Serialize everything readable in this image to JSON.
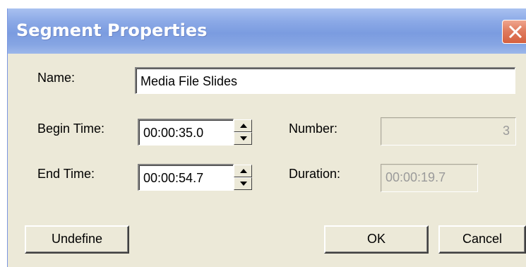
{
  "window": {
    "title": "Segment Properties",
    "close_icon": "close-icon"
  },
  "form": {
    "name_label": "Name:",
    "name_value": "Media File Slides",
    "begin_time_label": "Begin Time:",
    "begin_time_value": "00:00:35.0",
    "end_time_label": "End Time:",
    "end_time_value": "00:00:54.7",
    "number_label": "Number:",
    "number_value": "3",
    "duration_label": "Duration:",
    "duration_value": "00:00:19.7"
  },
  "buttons": {
    "undefine_label": "Undefine",
    "ok_label": "OK",
    "cancel_label": "Cancel"
  },
  "colors": {
    "titlebar": "#8aa8e6",
    "dialog_bg": "#ece9d8",
    "close_button": "#d5603f"
  }
}
